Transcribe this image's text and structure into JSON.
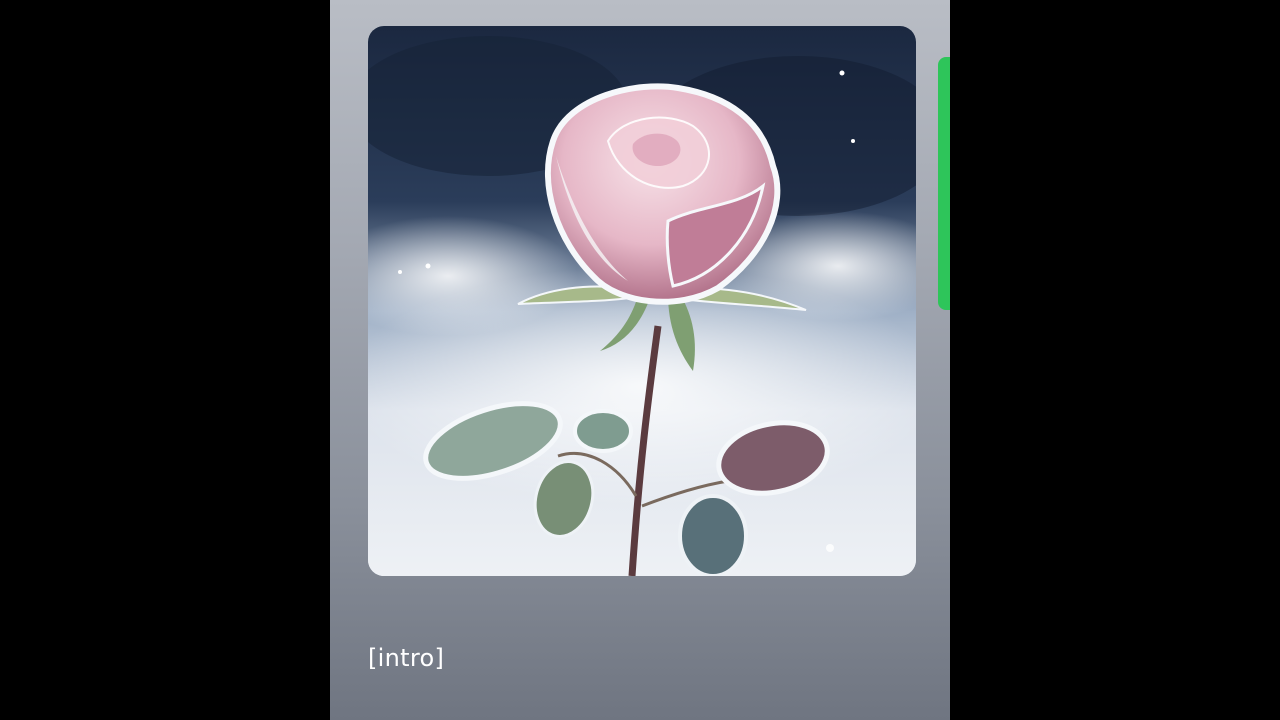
{
  "player": {
    "lyric_line": "[intro]"
  },
  "artwork": {
    "subject": "frosted-pink-rose",
    "palette": {
      "night_sky": "#1e2c45",
      "mist": "#e9edf3",
      "petal_pink": "#e8b9c8",
      "petal_deep": "#b4708d",
      "leaf": "#6d8a6c"
    }
  },
  "colors": {
    "background": "#000000",
    "panel_top": "#b9bdc5",
    "panel_bottom": "#6f7581",
    "accent_green": "#2ec55a",
    "text": "#ffffff"
  }
}
